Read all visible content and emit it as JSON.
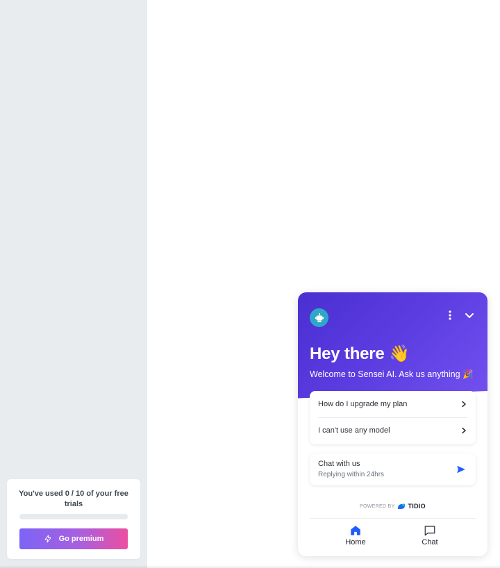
{
  "trial": {
    "text": "You've used 0 / 10 of your free trials",
    "progress": 0,
    "button_label": "Go premium",
    "button_icon": "lightning-icon"
  },
  "widget": {
    "header_title": "Hey there 👋",
    "welcome": "Welcome to Sensei AI. Ask us anything 🎉",
    "quick_replies": [
      {
        "label": "How do I upgrade my plan"
      },
      {
        "label": "I can't use any model"
      }
    ],
    "chat": {
      "title": "Chat with us",
      "subtitle": "Replying within 24hrs"
    },
    "powered_by": "POWERED BY",
    "brand": "TIDIO",
    "nav": {
      "home": "Home",
      "chat": "Chat"
    },
    "colors": {
      "header_start": "#4a2fd1",
      "header_end": "#7352f0",
      "accent": "#1f5cff",
      "avatar": "#2ea8c9"
    }
  }
}
